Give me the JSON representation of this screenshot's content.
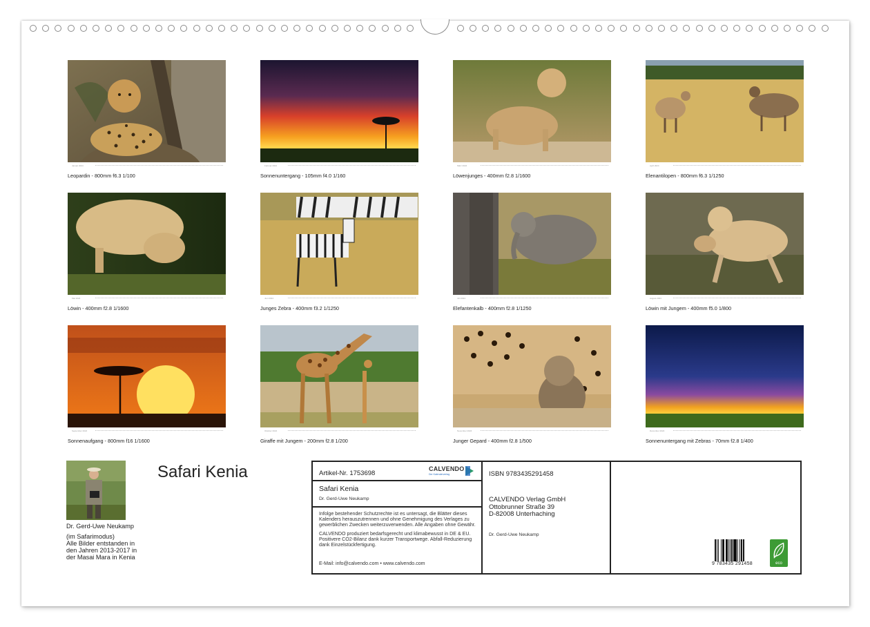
{
  "photos": [
    {
      "month": "Januar 2024",
      "caption": "Leopardin - 800mm f6.3 1/100",
      "subject": "leopard"
    },
    {
      "month": "Februar 2024",
      "caption": "Sonnenuntergang - 105mm f4.0 1/160",
      "subject": "sunset-tree"
    },
    {
      "month": "März 2024",
      "caption": "Löwenjunges - 400mm f2.8 1/1600",
      "subject": "lion-cub"
    },
    {
      "month": "April 2024",
      "caption": "Elenantilopen - 800mm f6.3 1/1250",
      "subject": "eland"
    },
    {
      "month": "Mai 2024",
      "caption": "Löwin - 400mm f2.8 1/1600",
      "subject": "lioness"
    },
    {
      "month": "Juni 2024",
      "caption": "Junges Zebra - 400mm f3.2 1/1250",
      "subject": "zebra"
    },
    {
      "month": "Juli 2024",
      "caption": "Elefantenkalb - 400mm f2.8 1/1250",
      "subject": "elephant-calf"
    },
    {
      "month": "August 2024",
      "caption": "Löwin mit Jungem - 400mm f5.0 1/800",
      "subject": "lioness-cub"
    },
    {
      "month": "September 2024",
      "caption": "Sonnenaufgang - 800mm f16 1/1600",
      "subject": "sunrise"
    },
    {
      "month": "Oktober 2024",
      "caption": "Giraffe mit Jungem - 200mm f2.8 1/200",
      "subject": "giraffe"
    },
    {
      "month": "November 2024",
      "caption": "Junger Gepard - 400mm f2.8 1/500",
      "subject": "cheetah-cub"
    },
    {
      "month": "Dezember 2024",
      "caption": "Sonnenuntergang mit Zebras - 70mm f2.8 1/400",
      "subject": "storm-sunset"
    }
  ],
  "title": "Safari Kenia",
  "author": {
    "name": "Dr. Gerd-Uwe Neukamp",
    "lines": [
      "(im Safarimodus)",
      "Alle Bilder entstanden in",
      "den Jahren 2013-2017 in",
      "der Masai Mara in Kenia"
    ]
  },
  "infobox": {
    "article": "Artikel-Nr. 1753698",
    "logo_name": "CALVENDO",
    "logo_tagline": "Der Kalenderverlag",
    "title": "Safari Kenia",
    "author": "Dr. Gerd-Uwe Neukamp",
    "legal1": "Infolge bestehender Schutzrechte ist es untersagt, die Blätter dieses Kalenders herauszutrennen und ohne Genehmigung des Verlages zu gewerblichen Zwecken weiterzuverwenden. Alle Angaben ohne Gewähr.",
    "legal2": "CALVENDO produziert bedarfsgerecht und klimabewusst in DE & EU. Positivere CO2-Bilanz dank kurzer Transportwege. Abfall-Reduzierung dank Einzelstückfertigung.",
    "contact": "E-Mail: info@calvendo.com • www.calvendo.com",
    "isbn": "ISBN 9783435291458",
    "publisher": [
      "CALVENDO Verlag GmbH",
      "Ottobrunner Straße 39",
      "D-82008 Unterhaching"
    ],
    "publisher_author": "Dr. Gerd-Uwe Neukamp",
    "barcode_number": "9 783435 291458",
    "eco_label": "eco"
  },
  "colors": {
    "frame": "#222222",
    "eco_green": "#3d9b35",
    "calvendo_blue": "#2a6ec0"
  }
}
